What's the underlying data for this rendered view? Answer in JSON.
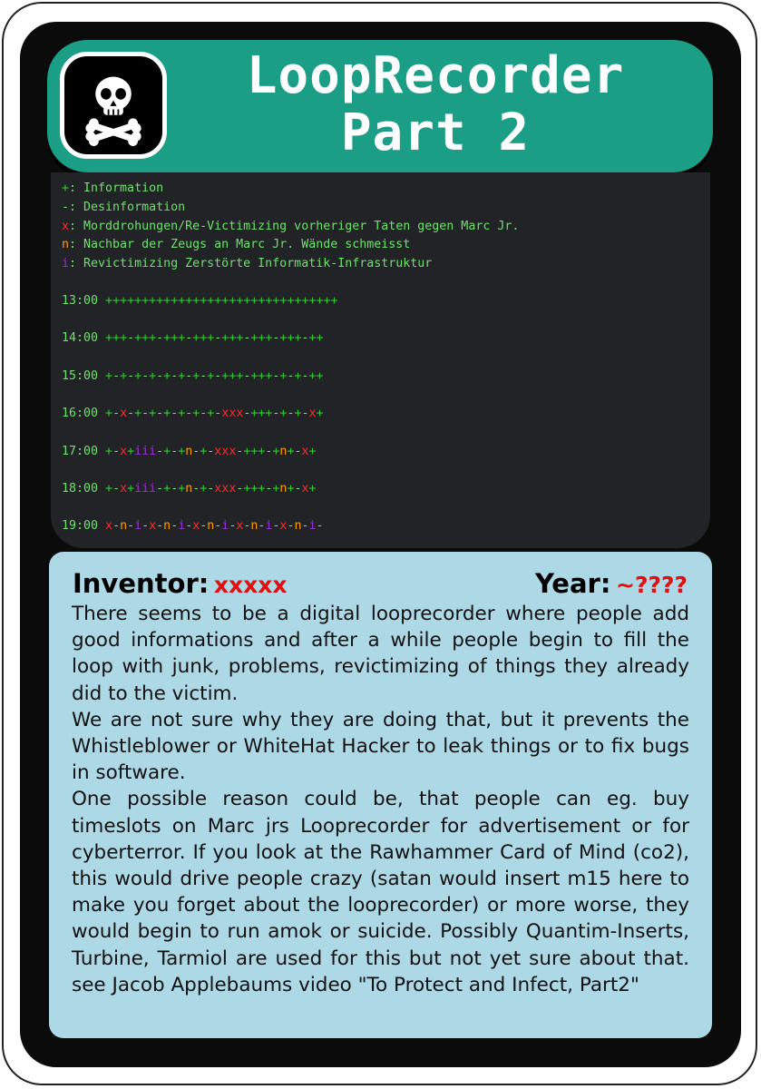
{
  "card": {
    "title_line1": "LoopRecorder",
    "title_line2": "Part 2",
    "icon": "skull-crossbones-icon"
  },
  "legend": [
    {
      "symbol": "+",
      "text": ": Information",
      "color": "#2ecc2e"
    },
    {
      "symbol": "-",
      "text": ": Desinformation",
      "color": "#6ee06e"
    },
    {
      "symbol": "x",
      "text": ": Morddrohungen/Re-Victimizing vorheriger Taten gegen Marc Jr.",
      "color": "#ff2a2a"
    },
    {
      "symbol": "n",
      "text": ": Nachbar der Zeugs an Marc Jr. Wände schmeisst",
      "color": "#ff9d00"
    },
    {
      "symbol": "i",
      "text": ": Revictimizing Zerstörte Informatik-Infrastruktur",
      "color": "#9b30d0"
    }
  ],
  "timeline": [
    {
      "time": "13:00",
      "pattern": "++++++++++++++++++++++++++++++++"
    },
    {
      "time": "14:00",
      "pattern": "+++-+++-+++-+++-+++-+++-+++-++"
    },
    {
      "time": "15:00",
      "pattern": "+-+-+-+-+-+-+-+-+++-+++-+-+-++"
    },
    {
      "time": "16:00",
      "pattern": "+-x-+-+-+-+-+-+-xxx-+++-+-+-x+"
    },
    {
      "time": "17:00",
      "pattern": "+-x+iii-+-+n-+-xxx-+++-+n+-x+"
    },
    {
      "time": "18:00",
      "pattern": "+-x+iii-+-+n-+-xxx-+++-+n+-x+"
    },
    {
      "time": "19:00",
      "pattern": "x-n-i-x-n-i-x-n-i-x-n-i-x-n-i-"
    }
  ],
  "info": {
    "inventor_label": "Inventor:",
    "inventor_value": "xxxxx",
    "year_label": "Year:",
    "year_value": "~????",
    "paragraphs": [
      "There seems to be a digital looprecorder where people add good informations and after a while people begin to fill the loop with junk, problems, revictimizing of things they already did to the victim.",
      "We are not sure why they are doing that, but it prevents the Whistleblower or WhiteHat Hacker to leak things or to fix bugs in software.",
      "One possible reason could be, that people can eg. buy timeslots on Marc jrs Looprecorder for advertisement or for cyberterror. If you look at the Rawhammer Card of Mind (co2), this would drive people crazy (satan would insert m15 here to make you forget about the looprecorder) or more worse, they would begin to run amok or suicide. Possibly Quantim-Inserts, Turbine, Tarmiol are used for this but not yet sure about that. see Jacob Applebaums video \"To Protect and Infect, Part2\""
    ]
  },
  "colors": {
    "header_teal": "#1a9e86",
    "terminal_bg": "#222326",
    "panel_blue": "#add8e6",
    "info_red": "#ff2a2a",
    "disinfo_green": "#6ee06e",
    "threat_orange": "#ff9d00",
    "revictim_purple": "#9b30d0"
  }
}
